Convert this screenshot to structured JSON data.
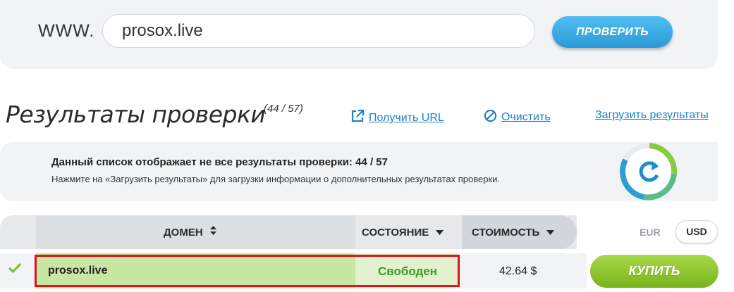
{
  "search": {
    "prefix": "WWW.",
    "value": "prosox.live",
    "button_label": "ПРОВЕРИТЬ"
  },
  "results": {
    "title": "Результаты проверки",
    "count": "(44 / 57)",
    "links": {
      "get_url": "Получить URL",
      "clear": "Очистить",
      "download": "Загрузить результаты"
    }
  },
  "notice": {
    "title": "Данный список отображает не все результаты проверки: 44 / 57",
    "text": "Нажмите на «Загрузить результаты» для загрузки информации о дополнительных результатах проверки."
  },
  "table": {
    "columns": {
      "domain": "ДОМЕН",
      "state": "СОСТОЯНИЕ",
      "cost": "СТОИМОСТЬ"
    },
    "currency": {
      "eur": "EUR",
      "usd": "USD",
      "selected": "USD"
    },
    "rows": [
      {
        "domain": "prosox.live",
        "state": "Свободен",
        "price": "42.64 $",
        "buy_label": "КУПИТЬ"
      }
    ]
  },
  "colors": {
    "accent_blue": "#2a9ad6",
    "link_blue": "#1f7fc4",
    "available_green": "#3a9d1e",
    "buy_green": "#79b41b",
    "highlight_red": "#e0131b"
  },
  "icons": {
    "get_url": "external-link-icon",
    "clear": "clear-circle-icon",
    "refresh": "refresh-icon",
    "row_status": "checkmark-icon",
    "sort": "sort-icon"
  }
}
